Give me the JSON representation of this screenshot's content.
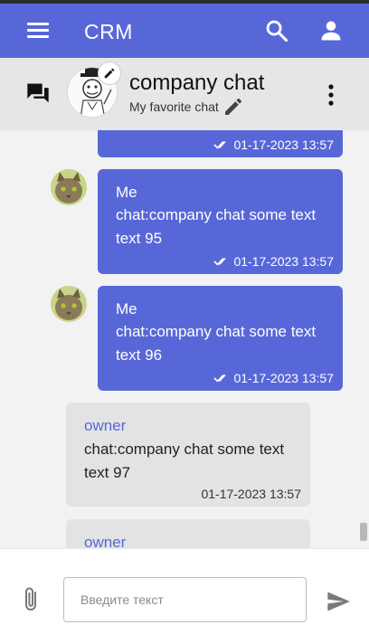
{
  "appbar": {
    "title": "CRM"
  },
  "chat": {
    "name": "company chat",
    "subtitle": "My favorite chat"
  },
  "messages": [
    {
      "kind": "mine",
      "time": "01-17-2023 13:57"
    },
    {
      "kind": "mine",
      "sender": "Me",
      "text": "chat:company chat some text text 95",
      "time": "01-17-2023 13:57"
    },
    {
      "kind": "mine",
      "sender": "Me",
      "text": "chat:company chat some text text 96",
      "time": "01-17-2023 13:57"
    },
    {
      "kind": "theirs",
      "sender": "owner",
      "text": "chat:company chat some text text 97",
      "time": "01-17-2023 13:57"
    },
    {
      "kind": "theirs",
      "sender": "owner"
    }
  ],
  "composer": {
    "placeholder": "Введите текст"
  },
  "icons": {
    "menu": "menu-icon",
    "search": "search-icon",
    "account": "account-icon",
    "forum": "forum-icon",
    "edit": "pencil-icon",
    "more": "more-vert-icon",
    "read": "double-check-icon",
    "attach": "paperclip-icon",
    "send": "send-icon"
  },
  "colors": {
    "primary": "#5867d8",
    "header_bg": "#e6e6e6",
    "messages_bg": "#f2f2f2",
    "incoming_bubble": "#e3e3e3"
  }
}
